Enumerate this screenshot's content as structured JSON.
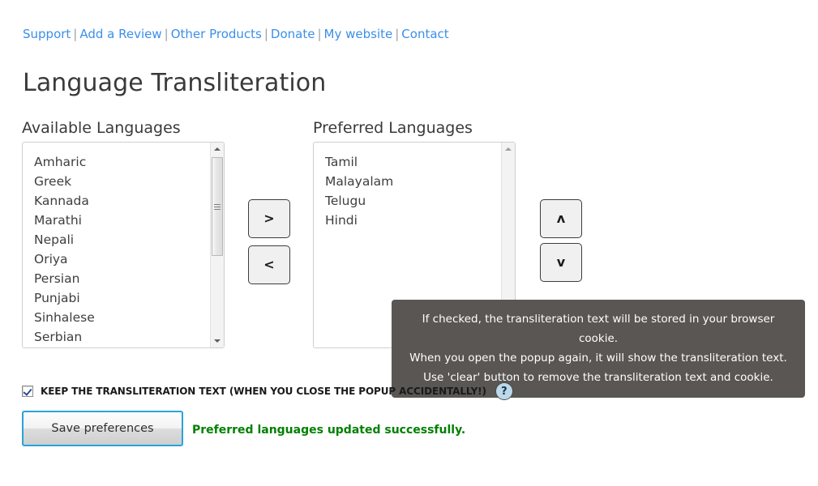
{
  "nav": {
    "separator": "|",
    "links": [
      {
        "label": "Support"
      },
      {
        "label": "Add a Review"
      },
      {
        "label": "Other Products"
      },
      {
        "label": "Donate"
      },
      {
        "label": "My website"
      },
      {
        "label": "Contact"
      }
    ]
  },
  "page": {
    "title": "Language Transliteration"
  },
  "available": {
    "heading": "Available Languages",
    "items": [
      "Amharic",
      "Greek",
      "Kannada",
      "Marathi",
      "Nepali",
      "Oriya",
      "Persian",
      "Punjabi",
      "Sinhalese",
      "Serbian"
    ]
  },
  "preferred": {
    "heading": "Preferred Languages",
    "items": [
      "Tamil",
      "Malayalam",
      "Telugu",
      "Hindi"
    ]
  },
  "transfer_buttons": {
    "move_right": ">",
    "move_left": "<",
    "move_up": "ʌ",
    "move_down": "v"
  },
  "tooltip": {
    "lines": [
      "If checked, the transliteration text will be stored in your browser cookie.",
      "When you open the popup again, it will show the transliteration text.",
      "Use 'clear' button to remove the transliteration text and cookie."
    ]
  },
  "keep_text": {
    "label": "KEEP THE TRANSLITERATION TEXT (WHEN YOU CLOSE THE POPUP ACCIDENTALLY!)",
    "checked": true,
    "help_glyph": "?"
  },
  "actions": {
    "save_label": "Save preferences",
    "status_message": "Preferred languages updated successfully."
  },
  "colors": {
    "link": "#3b8fe8",
    "success": "#008000",
    "tooltip_bg": "#595653",
    "focus_ring": "#29a3dc",
    "help_bg": "#bcd9ea"
  }
}
